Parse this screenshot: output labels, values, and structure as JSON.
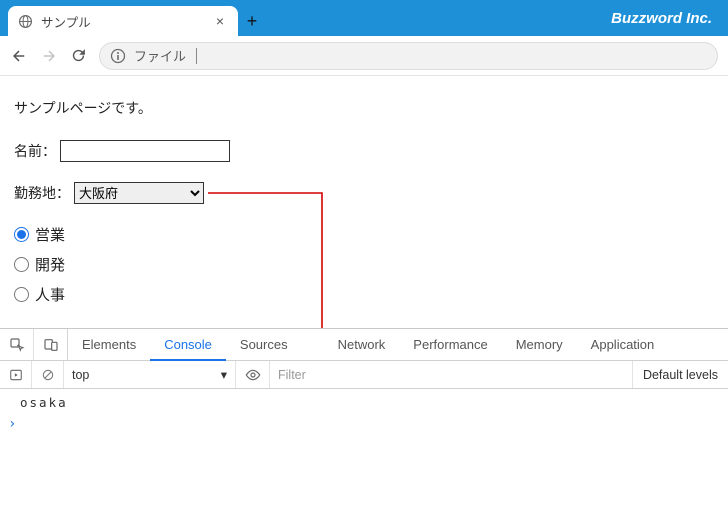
{
  "browser": {
    "tab_title": "サンプル",
    "brand": "Buzzword Inc.",
    "address_label": "ファイル"
  },
  "page": {
    "heading": "サンプルページです。",
    "name_label": "名前：",
    "name_value": "",
    "location_label": "勤務地：",
    "location_value": "大阪府",
    "radios": {
      "r1": "営業",
      "r2": "開発",
      "r3": "人事"
    }
  },
  "devtools": {
    "tabs": {
      "elements": "Elements",
      "console": "Console",
      "sources": "Sources",
      "network": "Network",
      "performance": "Performance",
      "memory": "Memory",
      "application": "Application"
    },
    "context": "top",
    "filter_placeholder": "Filter",
    "levels": "Default levels",
    "log_output": "osaka",
    "prompt": "›"
  }
}
